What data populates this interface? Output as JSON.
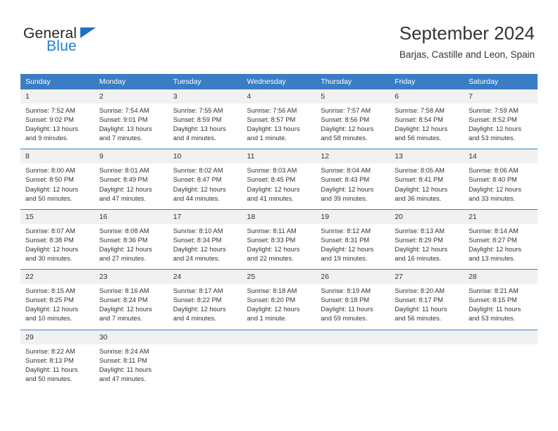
{
  "brand": {
    "name_part1": "General",
    "name_part2": "Blue",
    "triangle_color": "#1f6fc4",
    "blue_color": "#1f7fd4"
  },
  "header": {
    "title": "September 2024",
    "subtitle": "Barjas, Castille and Leon, Spain"
  },
  "theme": {
    "header_row_bg": "#3b7dc4",
    "header_row_text": "#ffffff",
    "day_number_bg": "#f1f1f1",
    "row_divider": "#3b7dc4",
    "body_text": "#333333"
  },
  "weekdays": [
    "Sunday",
    "Monday",
    "Tuesday",
    "Wednesday",
    "Thursday",
    "Friday",
    "Saturday"
  ],
  "weeks": [
    [
      {
        "day": "1",
        "sunrise": "Sunrise: 7:52 AM",
        "sunset": "Sunset: 9:02 PM",
        "daylight_1": "Daylight: 13 hours",
        "daylight_2": "and 9 minutes."
      },
      {
        "day": "2",
        "sunrise": "Sunrise: 7:54 AM",
        "sunset": "Sunset: 9:01 PM",
        "daylight_1": "Daylight: 13 hours",
        "daylight_2": "and 7 minutes."
      },
      {
        "day": "3",
        "sunrise": "Sunrise: 7:55 AM",
        "sunset": "Sunset: 8:59 PM",
        "daylight_1": "Daylight: 13 hours",
        "daylight_2": "and 4 minutes."
      },
      {
        "day": "4",
        "sunrise": "Sunrise: 7:56 AM",
        "sunset": "Sunset: 8:57 PM",
        "daylight_1": "Daylight: 13 hours",
        "daylight_2": "and 1 minute."
      },
      {
        "day": "5",
        "sunrise": "Sunrise: 7:57 AM",
        "sunset": "Sunset: 8:56 PM",
        "daylight_1": "Daylight: 12 hours",
        "daylight_2": "and 58 minutes."
      },
      {
        "day": "6",
        "sunrise": "Sunrise: 7:58 AM",
        "sunset": "Sunset: 8:54 PM",
        "daylight_1": "Daylight: 12 hours",
        "daylight_2": "and 56 minutes."
      },
      {
        "day": "7",
        "sunrise": "Sunrise: 7:59 AM",
        "sunset": "Sunset: 8:52 PM",
        "daylight_1": "Daylight: 12 hours",
        "daylight_2": "and 53 minutes."
      }
    ],
    [
      {
        "day": "8",
        "sunrise": "Sunrise: 8:00 AM",
        "sunset": "Sunset: 8:50 PM",
        "daylight_1": "Daylight: 12 hours",
        "daylight_2": "and 50 minutes."
      },
      {
        "day": "9",
        "sunrise": "Sunrise: 8:01 AM",
        "sunset": "Sunset: 8:49 PM",
        "daylight_1": "Daylight: 12 hours",
        "daylight_2": "and 47 minutes."
      },
      {
        "day": "10",
        "sunrise": "Sunrise: 8:02 AM",
        "sunset": "Sunset: 8:47 PM",
        "daylight_1": "Daylight: 12 hours",
        "daylight_2": "and 44 minutes."
      },
      {
        "day": "11",
        "sunrise": "Sunrise: 8:03 AM",
        "sunset": "Sunset: 8:45 PM",
        "daylight_1": "Daylight: 12 hours",
        "daylight_2": "and 41 minutes."
      },
      {
        "day": "12",
        "sunrise": "Sunrise: 8:04 AM",
        "sunset": "Sunset: 8:43 PM",
        "daylight_1": "Daylight: 12 hours",
        "daylight_2": "and 39 minutes."
      },
      {
        "day": "13",
        "sunrise": "Sunrise: 8:05 AM",
        "sunset": "Sunset: 8:41 PM",
        "daylight_1": "Daylight: 12 hours",
        "daylight_2": "and 36 minutes."
      },
      {
        "day": "14",
        "sunrise": "Sunrise: 8:06 AM",
        "sunset": "Sunset: 8:40 PM",
        "daylight_1": "Daylight: 12 hours",
        "daylight_2": "and 33 minutes."
      }
    ],
    [
      {
        "day": "15",
        "sunrise": "Sunrise: 8:07 AM",
        "sunset": "Sunset: 8:38 PM",
        "daylight_1": "Daylight: 12 hours",
        "daylight_2": "and 30 minutes."
      },
      {
        "day": "16",
        "sunrise": "Sunrise: 8:08 AM",
        "sunset": "Sunset: 8:36 PM",
        "daylight_1": "Daylight: 12 hours",
        "daylight_2": "and 27 minutes."
      },
      {
        "day": "17",
        "sunrise": "Sunrise: 8:10 AM",
        "sunset": "Sunset: 8:34 PM",
        "daylight_1": "Daylight: 12 hours",
        "daylight_2": "and 24 minutes."
      },
      {
        "day": "18",
        "sunrise": "Sunrise: 8:11 AM",
        "sunset": "Sunset: 8:33 PM",
        "daylight_1": "Daylight: 12 hours",
        "daylight_2": "and 22 minutes."
      },
      {
        "day": "19",
        "sunrise": "Sunrise: 8:12 AM",
        "sunset": "Sunset: 8:31 PM",
        "daylight_1": "Daylight: 12 hours",
        "daylight_2": "and 19 minutes."
      },
      {
        "day": "20",
        "sunrise": "Sunrise: 8:13 AM",
        "sunset": "Sunset: 8:29 PM",
        "daylight_1": "Daylight: 12 hours",
        "daylight_2": "and 16 minutes."
      },
      {
        "day": "21",
        "sunrise": "Sunrise: 8:14 AM",
        "sunset": "Sunset: 8:27 PM",
        "daylight_1": "Daylight: 12 hours",
        "daylight_2": "and 13 minutes."
      }
    ],
    [
      {
        "day": "22",
        "sunrise": "Sunrise: 8:15 AM",
        "sunset": "Sunset: 8:25 PM",
        "daylight_1": "Daylight: 12 hours",
        "daylight_2": "and 10 minutes."
      },
      {
        "day": "23",
        "sunrise": "Sunrise: 8:16 AM",
        "sunset": "Sunset: 8:24 PM",
        "daylight_1": "Daylight: 12 hours",
        "daylight_2": "and 7 minutes."
      },
      {
        "day": "24",
        "sunrise": "Sunrise: 8:17 AM",
        "sunset": "Sunset: 8:22 PM",
        "daylight_1": "Daylight: 12 hours",
        "daylight_2": "and 4 minutes."
      },
      {
        "day": "25",
        "sunrise": "Sunrise: 8:18 AM",
        "sunset": "Sunset: 8:20 PM",
        "daylight_1": "Daylight: 12 hours",
        "daylight_2": "and 1 minute."
      },
      {
        "day": "26",
        "sunrise": "Sunrise: 8:19 AM",
        "sunset": "Sunset: 8:18 PM",
        "daylight_1": "Daylight: 11 hours",
        "daylight_2": "and 59 minutes."
      },
      {
        "day": "27",
        "sunrise": "Sunrise: 8:20 AM",
        "sunset": "Sunset: 8:17 PM",
        "daylight_1": "Daylight: 11 hours",
        "daylight_2": "and 56 minutes."
      },
      {
        "day": "28",
        "sunrise": "Sunrise: 8:21 AM",
        "sunset": "Sunset: 8:15 PM",
        "daylight_1": "Daylight: 11 hours",
        "daylight_2": "and 53 minutes."
      }
    ],
    [
      {
        "day": "29",
        "sunrise": "Sunrise: 8:22 AM",
        "sunset": "Sunset: 8:13 PM",
        "daylight_1": "Daylight: 11 hours",
        "daylight_2": "and 50 minutes."
      },
      {
        "day": "30",
        "sunrise": "Sunrise: 8:24 AM",
        "sunset": "Sunset: 8:11 PM",
        "daylight_1": "Daylight: 11 hours",
        "daylight_2": "and 47 minutes."
      },
      {
        "day": "",
        "sunrise": "",
        "sunset": "",
        "daylight_1": "",
        "daylight_2": ""
      },
      {
        "day": "",
        "sunrise": "",
        "sunset": "",
        "daylight_1": "",
        "daylight_2": ""
      },
      {
        "day": "",
        "sunrise": "",
        "sunset": "",
        "daylight_1": "",
        "daylight_2": ""
      },
      {
        "day": "",
        "sunrise": "",
        "sunset": "",
        "daylight_1": "",
        "daylight_2": ""
      },
      {
        "day": "",
        "sunrise": "",
        "sunset": "",
        "daylight_1": "",
        "daylight_2": ""
      }
    ]
  ]
}
